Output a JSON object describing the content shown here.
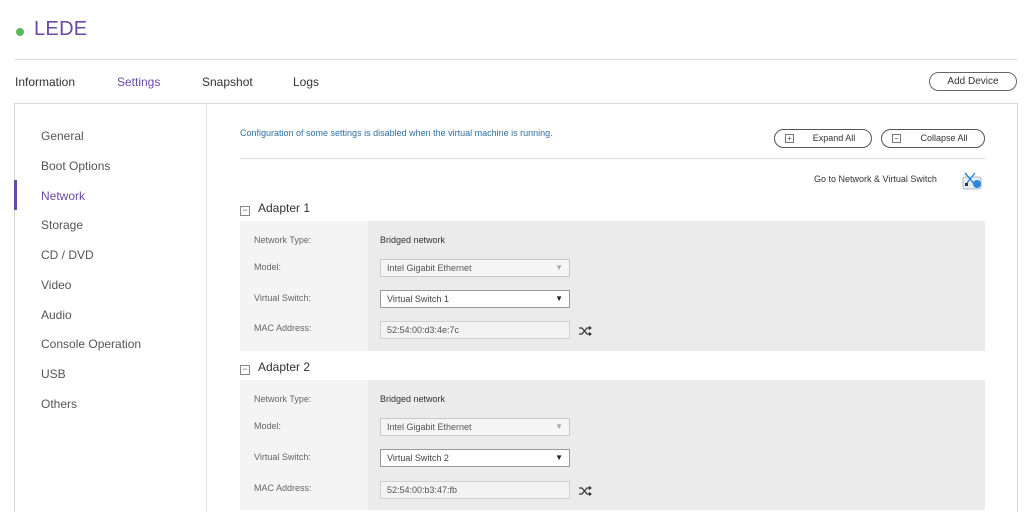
{
  "vm": {
    "title": "LEDE",
    "status_color": "#5cb85c"
  },
  "tabs": [
    {
      "label": "Information"
    },
    {
      "label": "Settings"
    },
    {
      "label": "Snapshot"
    },
    {
      "label": "Logs"
    }
  ],
  "active_tab": "Settings",
  "add_device_label": "Add Device",
  "sidebar": {
    "items": [
      {
        "label": "General"
      },
      {
        "label": "Boot Options"
      },
      {
        "label": "Network"
      },
      {
        "label": "Storage"
      },
      {
        "label": "CD / DVD"
      },
      {
        "label": "Video"
      },
      {
        "label": "Audio"
      },
      {
        "label": "Console Operation"
      },
      {
        "label": "USB"
      },
      {
        "label": "Others"
      }
    ],
    "active": "Network"
  },
  "content": {
    "notice": "Configuration of some settings is disabled when the virtual machine is running.",
    "expand_all": "Expand All",
    "collapse_all": "Collapse All",
    "goto_link": "Go to Network & Virtual Switch"
  },
  "adapters": [
    {
      "title": "Adapter 1",
      "network_type_label": "Network Type:",
      "network_type": "Bridged network",
      "model_label": "Model:",
      "model": "Intel Gigabit Ethernet",
      "switch_label": "Virtual Switch:",
      "switch": "Virtual Switch 1",
      "mac_label": "MAC Address:",
      "mac": "52:54:00:d3:4e:7c"
    },
    {
      "title": "Adapter 2",
      "network_type_label": "Network Type:",
      "network_type": "Bridged network",
      "model_label": "Model:",
      "model": "Intel Gigabit Ethernet",
      "switch_label": "Virtual Switch:",
      "switch": "Virtual Switch 2",
      "mac_label": "MAC Address:",
      "mac": "52:54:00:b3:47:fb"
    }
  ],
  "colors": {
    "accent": "#6a4aa5",
    "notice": "#2f6f9f",
    "status": "#5cb85c"
  },
  "icons": {
    "collapse": "minus-square-icon",
    "expand": "plus-square-icon",
    "mac_regen": "shuffle-icon",
    "network": "network-switch-icon"
  }
}
